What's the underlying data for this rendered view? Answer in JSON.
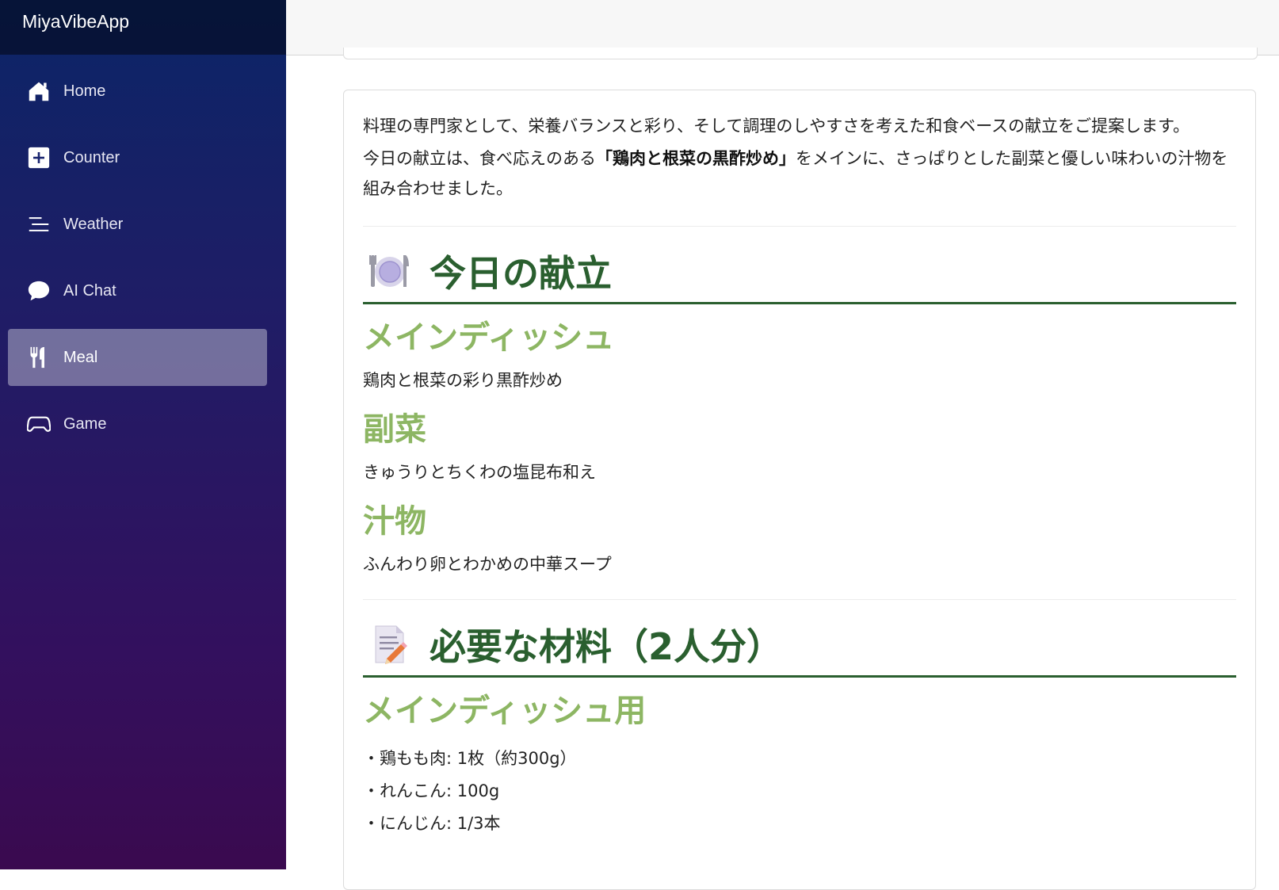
{
  "app": {
    "title": "MiyaVibeApp"
  },
  "nav": {
    "items": [
      {
        "label": "Home",
        "icon": "house-icon",
        "active": false
      },
      {
        "label": "Counter",
        "icon": "plus-square-icon",
        "active": false
      },
      {
        "label": "Weather",
        "icon": "list-lines-icon",
        "active": false
      },
      {
        "label": "AI Chat",
        "icon": "chat-bubble-icon",
        "active": false
      },
      {
        "label": "Meal",
        "icon": "fork-knife-icon",
        "active": true
      },
      {
        "label": "Game",
        "icon": "gamepad-icon",
        "active": false
      }
    ]
  },
  "content": {
    "intro": {
      "line1": "料理の専門家として、栄養バランスと彩り、そして調理のしやすさを考えた和食ベースの献立をご提案します。",
      "line2_before": "今日の献立は、食べ応えのある",
      "line2_bold": "「鶏肉と根菜の黒酢炒め」",
      "line2_after": "をメインに、さっぱりとした副菜と優しい味わいの汁物を組み合わせました。"
    },
    "menu_section": {
      "emoji": "plate-with-cutlery-icon",
      "title": "今日の献立",
      "items": [
        {
          "heading": "メインディッシュ",
          "text": "鶏肉と根菜の彩り黒酢炒め"
        },
        {
          "heading": "副菜",
          "text": "きゅうりとちくわの塩昆布和え"
        },
        {
          "heading": "汁物",
          "text": "ふんわり卵とわかめの中華スープ"
        }
      ]
    },
    "ingredients_section": {
      "emoji": "memo-pencil-icon",
      "title": "必要な材料（2人分）",
      "subheading": "メインディッシュ用",
      "items": [
        "・鶏もも肉: 1枚（約300g）",
        "・れんこん: 100g",
        "・にんじん: 1/3本"
      ]
    }
  },
  "colors": {
    "heading_dark_green": "#2a5f2f",
    "heading_light_green": "#8db663",
    "sidebar_top": "#0b2567",
    "sidebar_bottom": "#3a0a4f"
  }
}
